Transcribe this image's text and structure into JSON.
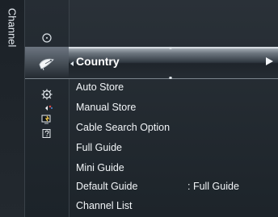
{
  "sidebar": {
    "title": "Channel"
  },
  "menu": {
    "selected": "Country",
    "items": [
      "Auto Store",
      "Manual Store",
      "Cable Search Option",
      "Full Guide",
      "Mini Guide",
      "Default Guide",
      "Channel List"
    ],
    "default_guide_value": ": Full Guide"
  },
  "icons": [
    "power-icon",
    "satellite-dish-icon",
    "gear-icon",
    "sound-icon",
    "channel-icon",
    "help-icon"
  ]
}
